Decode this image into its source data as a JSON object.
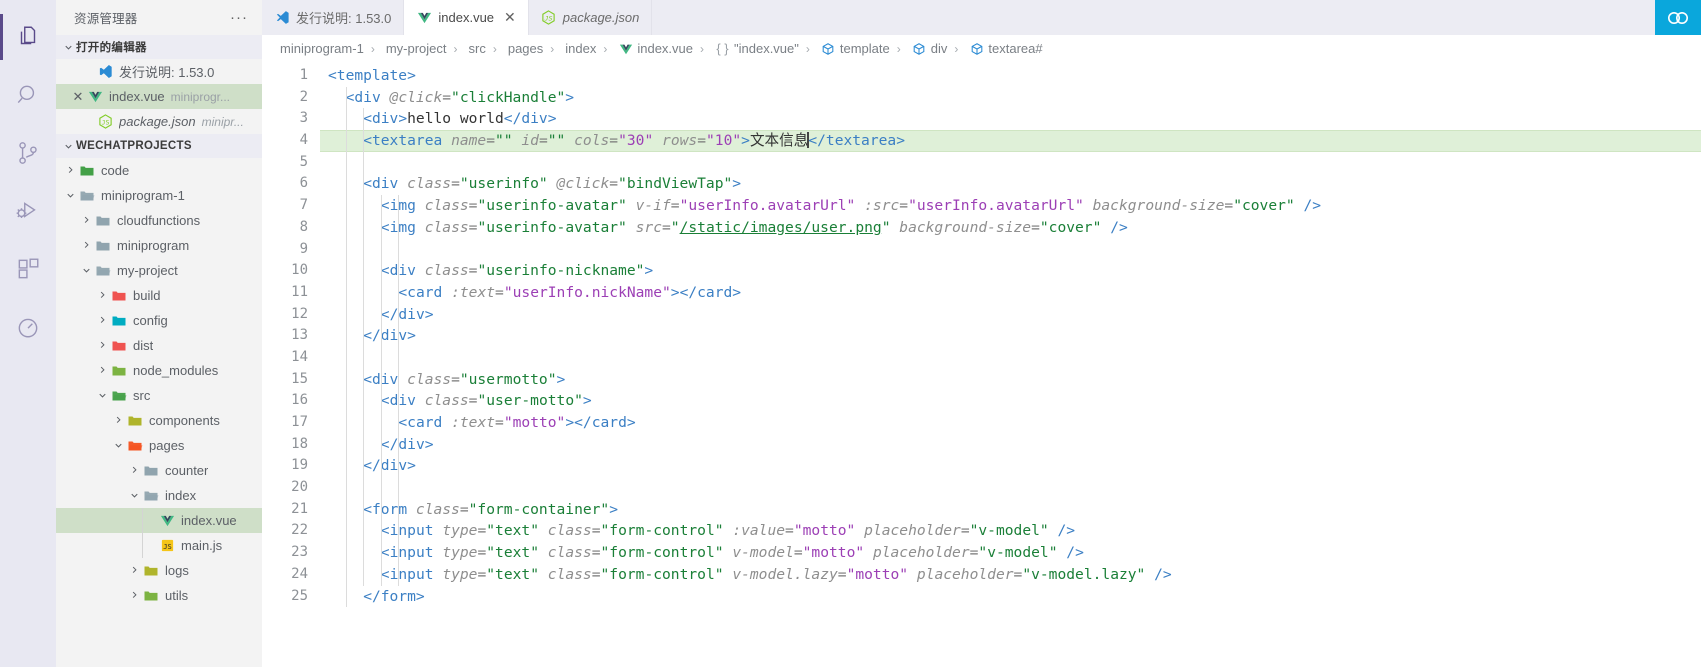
{
  "activitybar": {
    "items": [
      {
        "name": "explorer-icon",
        "label": "资源管理器",
        "active": true
      },
      {
        "name": "search-icon",
        "label": "搜索",
        "active": false
      },
      {
        "name": "source-control-icon",
        "label": "源代码管理",
        "active": false
      },
      {
        "name": "run-debug-icon",
        "label": "运行和调试",
        "active": false
      },
      {
        "name": "extensions-icon",
        "label": "扩展",
        "active": false
      },
      {
        "name": "test-icon",
        "label": "测试",
        "active": false
      }
    ]
  },
  "sidebar": {
    "title": "资源管理器",
    "more_actions": "···",
    "open_editors": {
      "header": "打开的编辑器",
      "items": [
        {
          "icon": "vscode-icon",
          "label": "发行说明: 1.53.0",
          "detail": "",
          "selected": false,
          "italic": false,
          "close": false
        },
        {
          "icon": "vue-icon",
          "label": "index.vue",
          "detail": "miniprogr...",
          "selected": true,
          "italic": false,
          "close": true
        },
        {
          "icon": "nodejs-icon",
          "label": "package.json",
          "detail": "minipr...",
          "selected": false,
          "italic": true,
          "close": false
        }
      ]
    },
    "workspace": {
      "header": "WECHATPROJECTS",
      "tree": [
        {
          "label": "code",
          "depth": 1,
          "type": "folder",
          "state": "collapsed",
          "color": "f-green"
        },
        {
          "label": "miniprogram-1",
          "depth": 1,
          "type": "folder",
          "state": "expanded",
          "color": "f-gray"
        },
        {
          "label": "cloudfunctions",
          "depth": 2,
          "type": "folder",
          "state": "collapsed",
          "color": "f-gray"
        },
        {
          "label": "miniprogram",
          "depth": 2,
          "type": "folder",
          "state": "collapsed",
          "color": "f-gray"
        },
        {
          "label": "my-project",
          "depth": 2,
          "type": "folder",
          "state": "expanded",
          "color": "f-gray"
        },
        {
          "label": "build",
          "depth": 3,
          "type": "folder",
          "state": "collapsed",
          "color": "f-pink"
        },
        {
          "label": "config",
          "depth": 3,
          "type": "folder",
          "state": "collapsed",
          "color": "f-teal"
        },
        {
          "label": "dist",
          "depth": 3,
          "type": "folder",
          "state": "collapsed",
          "color": "f-pink"
        },
        {
          "label": "node_modules",
          "depth": 3,
          "type": "folder",
          "state": "collapsed",
          "color": "f-lgreen"
        },
        {
          "label": "src",
          "depth": 3,
          "type": "folder",
          "state": "expanded",
          "color": "f-green"
        },
        {
          "label": "components",
          "depth": 4,
          "type": "folder",
          "state": "collapsed",
          "color": "f-olive"
        },
        {
          "label": "pages",
          "depth": 4,
          "type": "folder",
          "state": "expanded",
          "color": "f-orange"
        },
        {
          "label": "counter",
          "depth": 5,
          "type": "folder",
          "state": "collapsed",
          "color": "f-gray"
        },
        {
          "label": "index",
          "depth": 5,
          "type": "folder",
          "state": "expanded",
          "color": "f-gray"
        },
        {
          "label": "index.vue",
          "depth": 6,
          "type": "file",
          "icon": "vue-icon",
          "selected": true
        },
        {
          "label": "main.js",
          "depth": 6,
          "type": "file",
          "icon": "js-icon",
          "selected": false
        },
        {
          "label": "logs",
          "depth": 5,
          "type": "folder",
          "state": "collapsed",
          "color": "f-olive"
        },
        {
          "label": "utils",
          "depth": 5,
          "type": "folder",
          "state": "collapsed",
          "color": "f-lgreen"
        }
      ]
    }
  },
  "tabs": [
    {
      "label": "发行说明: 1.53.0",
      "icon": "vscode-icon",
      "active": false,
      "italic": false,
      "closable": false
    },
    {
      "label": "index.vue",
      "icon": "vue-icon",
      "active": true,
      "italic": false,
      "closable": true
    },
    {
      "label": "package.json",
      "icon": "nodejs-icon",
      "active": false,
      "italic": true,
      "closable": false
    }
  ],
  "tab_actions": {
    "accessibility_icon": "accessibility-icon"
  },
  "breadcrumbs": [
    {
      "label": "miniprogram-1",
      "icon": null
    },
    {
      "label": "my-project",
      "icon": null
    },
    {
      "label": "src",
      "icon": null
    },
    {
      "label": "pages",
      "icon": null
    },
    {
      "label": "index",
      "icon": null
    },
    {
      "label": "index.vue",
      "icon": "vue-icon"
    },
    {
      "label": "\"index.vue\"",
      "icon": "braces-icon"
    },
    {
      "label": "template",
      "icon": "symbol-field-icon"
    },
    {
      "label": "div",
      "icon": "symbol-field-icon"
    },
    {
      "label": "textarea#",
      "icon": "symbol-field-icon"
    }
  ],
  "editor": {
    "highlighted_line": 4,
    "first_line": 1,
    "lines": [
      {
        "n": 1,
        "indent": 0,
        "tokens": [
          {
            "t": "tag",
            "v": "<template>"
          }
        ]
      },
      {
        "n": 2,
        "indent": 1,
        "tokens": [
          {
            "t": "tag",
            "v": "<div "
          },
          {
            "t": "attr",
            "v": "@click"
          },
          {
            "t": "eq",
            "v": "="
          },
          {
            "t": "val",
            "v": "\"clickHandle\""
          },
          {
            "t": "tag",
            "v": ">"
          }
        ]
      },
      {
        "n": 3,
        "indent": 2,
        "tokens": [
          {
            "t": "tag",
            "v": "<div>"
          },
          {
            "t": "text",
            "v": "hello world"
          },
          {
            "t": "tag",
            "v": "</div>"
          }
        ]
      },
      {
        "n": 4,
        "indent": 2,
        "tokens": [
          {
            "t": "tag",
            "v": "<textarea "
          },
          {
            "t": "attr",
            "v": "name"
          },
          {
            "t": "eq",
            "v": "="
          },
          {
            "t": "val",
            "v": "\"\""
          },
          {
            "t": "plain",
            "v": " "
          },
          {
            "t": "attr",
            "v": "id"
          },
          {
            "t": "eq",
            "v": "="
          },
          {
            "t": "val",
            "v": "\"\""
          },
          {
            "t": "plain",
            "v": " "
          },
          {
            "t": "attr",
            "v": "cols"
          },
          {
            "t": "eq",
            "v": "="
          },
          {
            "t": "valp",
            "v": "\"30\""
          },
          {
            "t": "plain",
            "v": " "
          },
          {
            "t": "attr",
            "v": "rows"
          },
          {
            "t": "eq",
            "v": "="
          },
          {
            "t": "valp",
            "v": "\"10\""
          },
          {
            "t": "tag",
            "v": ">"
          },
          {
            "t": "text",
            "v": "文本信息"
          },
          {
            "t": "caret",
            "v": ""
          },
          {
            "t": "tag",
            "v": "</textarea>"
          }
        ]
      },
      {
        "n": 5,
        "indent": 2,
        "tokens": []
      },
      {
        "n": 6,
        "indent": 2,
        "tokens": [
          {
            "t": "tag",
            "v": "<div "
          },
          {
            "t": "attr",
            "v": "class"
          },
          {
            "t": "eq",
            "v": "="
          },
          {
            "t": "val",
            "v": "\"userinfo\""
          },
          {
            "t": "plain",
            "v": " "
          },
          {
            "t": "attr",
            "v": "@click"
          },
          {
            "t": "eq",
            "v": "="
          },
          {
            "t": "val",
            "v": "\"bindViewTap\""
          },
          {
            "t": "tag",
            "v": ">"
          }
        ]
      },
      {
        "n": 7,
        "indent": 3,
        "tokens": [
          {
            "t": "tag",
            "v": "<img "
          },
          {
            "t": "attr",
            "v": "class"
          },
          {
            "t": "eq",
            "v": "="
          },
          {
            "t": "val",
            "v": "\"userinfo-avatar\""
          },
          {
            "t": "plain",
            "v": " "
          },
          {
            "t": "attr",
            "v": "v-if"
          },
          {
            "t": "eq",
            "v": "="
          },
          {
            "t": "valp",
            "v": "\"userInfo.avatarUrl\""
          },
          {
            "t": "plain",
            "v": " "
          },
          {
            "t": "attr",
            "v": ":src"
          },
          {
            "t": "eq",
            "v": "="
          },
          {
            "t": "valp",
            "v": "\"userInfo.avatarUrl\""
          },
          {
            "t": "plain",
            "v": " "
          },
          {
            "t": "attr",
            "v": "background-size"
          },
          {
            "t": "eq",
            "v": "="
          },
          {
            "t": "val",
            "v": "\"cover\""
          },
          {
            "t": "plain",
            "v": " "
          },
          {
            "t": "tag",
            "v": "/>"
          }
        ]
      },
      {
        "n": 8,
        "indent": 3,
        "tokens": [
          {
            "t": "tag",
            "v": "<img "
          },
          {
            "t": "attr",
            "v": "class"
          },
          {
            "t": "eq",
            "v": "="
          },
          {
            "t": "val",
            "v": "\"userinfo-avatar\""
          },
          {
            "t": "plain",
            "v": " "
          },
          {
            "t": "attr",
            "v": "src"
          },
          {
            "t": "eq",
            "v": "="
          },
          {
            "t": "val",
            "v": "\""
          },
          {
            "t": "link",
            "v": "/static/images/user.png"
          },
          {
            "t": "val",
            "v": "\""
          },
          {
            "t": "plain",
            "v": " "
          },
          {
            "t": "attr",
            "v": "background-size"
          },
          {
            "t": "eq",
            "v": "="
          },
          {
            "t": "val",
            "v": "\"cover\""
          },
          {
            "t": "plain",
            "v": " "
          },
          {
            "t": "tag",
            "v": "/>"
          }
        ]
      },
      {
        "n": 9,
        "indent": 3,
        "tokens": []
      },
      {
        "n": 10,
        "indent": 3,
        "tokens": [
          {
            "t": "tag",
            "v": "<div "
          },
          {
            "t": "attr",
            "v": "class"
          },
          {
            "t": "eq",
            "v": "="
          },
          {
            "t": "val",
            "v": "\"userinfo-nickname\""
          },
          {
            "t": "tag",
            "v": ">"
          }
        ]
      },
      {
        "n": 11,
        "indent": 4,
        "tokens": [
          {
            "t": "tag",
            "v": "<card "
          },
          {
            "t": "attr",
            "v": ":text"
          },
          {
            "t": "eq",
            "v": "="
          },
          {
            "t": "valp",
            "v": "\"userInfo.nickName\""
          },
          {
            "t": "tag",
            "v": "></card>"
          }
        ]
      },
      {
        "n": 12,
        "indent": 3,
        "tokens": [
          {
            "t": "tag",
            "v": "</div>"
          }
        ]
      },
      {
        "n": 13,
        "indent": 2,
        "tokens": [
          {
            "t": "tag",
            "v": "</div>"
          }
        ]
      },
      {
        "n": 14,
        "indent": 2,
        "tokens": []
      },
      {
        "n": 15,
        "indent": 2,
        "tokens": [
          {
            "t": "tag",
            "v": "<div "
          },
          {
            "t": "attr",
            "v": "class"
          },
          {
            "t": "eq",
            "v": "="
          },
          {
            "t": "val",
            "v": "\"usermotto\""
          },
          {
            "t": "tag",
            "v": ">"
          }
        ]
      },
      {
        "n": 16,
        "indent": 3,
        "tokens": [
          {
            "t": "tag",
            "v": "<div "
          },
          {
            "t": "attr",
            "v": "class"
          },
          {
            "t": "eq",
            "v": "="
          },
          {
            "t": "val",
            "v": "\"user-motto\""
          },
          {
            "t": "tag",
            "v": ">"
          }
        ]
      },
      {
        "n": 17,
        "indent": 4,
        "tokens": [
          {
            "t": "tag",
            "v": "<card "
          },
          {
            "t": "attr",
            "v": ":text"
          },
          {
            "t": "eq",
            "v": "="
          },
          {
            "t": "valp",
            "v": "\"motto\""
          },
          {
            "t": "tag",
            "v": "></card>"
          }
        ]
      },
      {
        "n": 18,
        "indent": 3,
        "tokens": [
          {
            "t": "tag",
            "v": "</div>"
          }
        ]
      },
      {
        "n": 19,
        "indent": 2,
        "tokens": [
          {
            "t": "tag",
            "v": "</div>"
          }
        ]
      },
      {
        "n": 20,
        "indent": 2,
        "tokens": []
      },
      {
        "n": 21,
        "indent": 2,
        "tokens": [
          {
            "t": "tag",
            "v": "<form "
          },
          {
            "t": "attr",
            "v": "class"
          },
          {
            "t": "eq",
            "v": "="
          },
          {
            "t": "val",
            "v": "\"form-container\""
          },
          {
            "t": "tag",
            "v": ">"
          }
        ]
      },
      {
        "n": 22,
        "indent": 3,
        "tokens": [
          {
            "t": "tag",
            "v": "<input "
          },
          {
            "t": "attr",
            "v": "type"
          },
          {
            "t": "eq",
            "v": "="
          },
          {
            "t": "val",
            "v": "\"text\""
          },
          {
            "t": "plain",
            "v": " "
          },
          {
            "t": "attr",
            "v": "class"
          },
          {
            "t": "eq",
            "v": "="
          },
          {
            "t": "val",
            "v": "\"form-control\""
          },
          {
            "t": "plain",
            "v": " "
          },
          {
            "t": "attr",
            "v": ":value"
          },
          {
            "t": "eq",
            "v": "="
          },
          {
            "t": "valp",
            "v": "\"motto\""
          },
          {
            "t": "plain",
            "v": " "
          },
          {
            "t": "attr",
            "v": "placeholder"
          },
          {
            "t": "eq",
            "v": "="
          },
          {
            "t": "val",
            "v": "\"v-model\""
          },
          {
            "t": "plain",
            "v": " "
          },
          {
            "t": "tag",
            "v": "/>"
          }
        ]
      },
      {
        "n": 23,
        "indent": 3,
        "tokens": [
          {
            "t": "tag",
            "v": "<input "
          },
          {
            "t": "attr",
            "v": "type"
          },
          {
            "t": "eq",
            "v": "="
          },
          {
            "t": "val",
            "v": "\"text\""
          },
          {
            "t": "plain",
            "v": " "
          },
          {
            "t": "attr",
            "v": "class"
          },
          {
            "t": "eq",
            "v": "="
          },
          {
            "t": "val",
            "v": "\"form-control\""
          },
          {
            "t": "plain",
            "v": " "
          },
          {
            "t": "attr",
            "v": "v-model"
          },
          {
            "t": "eq",
            "v": "="
          },
          {
            "t": "valp",
            "v": "\"motto\""
          },
          {
            "t": "plain",
            "v": " "
          },
          {
            "t": "attr",
            "v": "placeholder"
          },
          {
            "t": "eq",
            "v": "="
          },
          {
            "t": "val",
            "v": "\"v-model\""
          },
          {
            "t": "plain",
            "v": " "
          },
          {
            "t": "tag",
            "v": "/>"
          }
        ]
      },
      {
        "n": 24,
        "indent": 3,
        "tokens": [
          {
            "t": "tag",
            "v": "<input "
          },
          {
            "t": "attr",
            "v": "type"
          },
          {
            "t": "eq",
            "v": "="
          },
          {
            "t": "val",
            "v": "\"text\""
          },
          {
            "t": "plain",
            "v": " "
          },
          {
            "t": "attr",
            "v": "class"
          },
          {
            "t": "eq",
            "v": "="
          },
          {
            "t": "val",
            "v": "\"form-control\""
          },
          {
            "t": "plain",
            "v": " "
          },
          {
            "t": "attr",
            "v": "v-model.lazy"
          },
          {
            "t": "eq",
            "v": "="
          },
          {
            "t": "valp",
            "v": "\"motto\""
          },
          {
            "t": "plain",
            "v": " "
          },
          {
            "t": "attr",
            "v": "placeholder"
          },
          {
            "t": "eq",
            "v": "="
          },
          {
            "t": "val",
            "v": "\"v-model.lazy\""
          },
          {
            "t": "plain",
            "v": " "
          },
          {
            "t": "tag",
            "v": "/>"
          }
        ]
      },
      {
        "n": 25,
        "indent": 2,
        "tokens": [
          {
            "t": "tag",
            "v": "</form>"
          }
        ]
      }
    ]
  },
  "colors": {
    "accent": "#0aa7dc",
    "selection": "#cfdfc8",
    "highlight_line": "#dff0d8",
    "activitybar_bg": "#e8e8f2",
    "sidebar_bg": "#f3f3f3",
    "editor_bg": "#ffffff"
  }
}
